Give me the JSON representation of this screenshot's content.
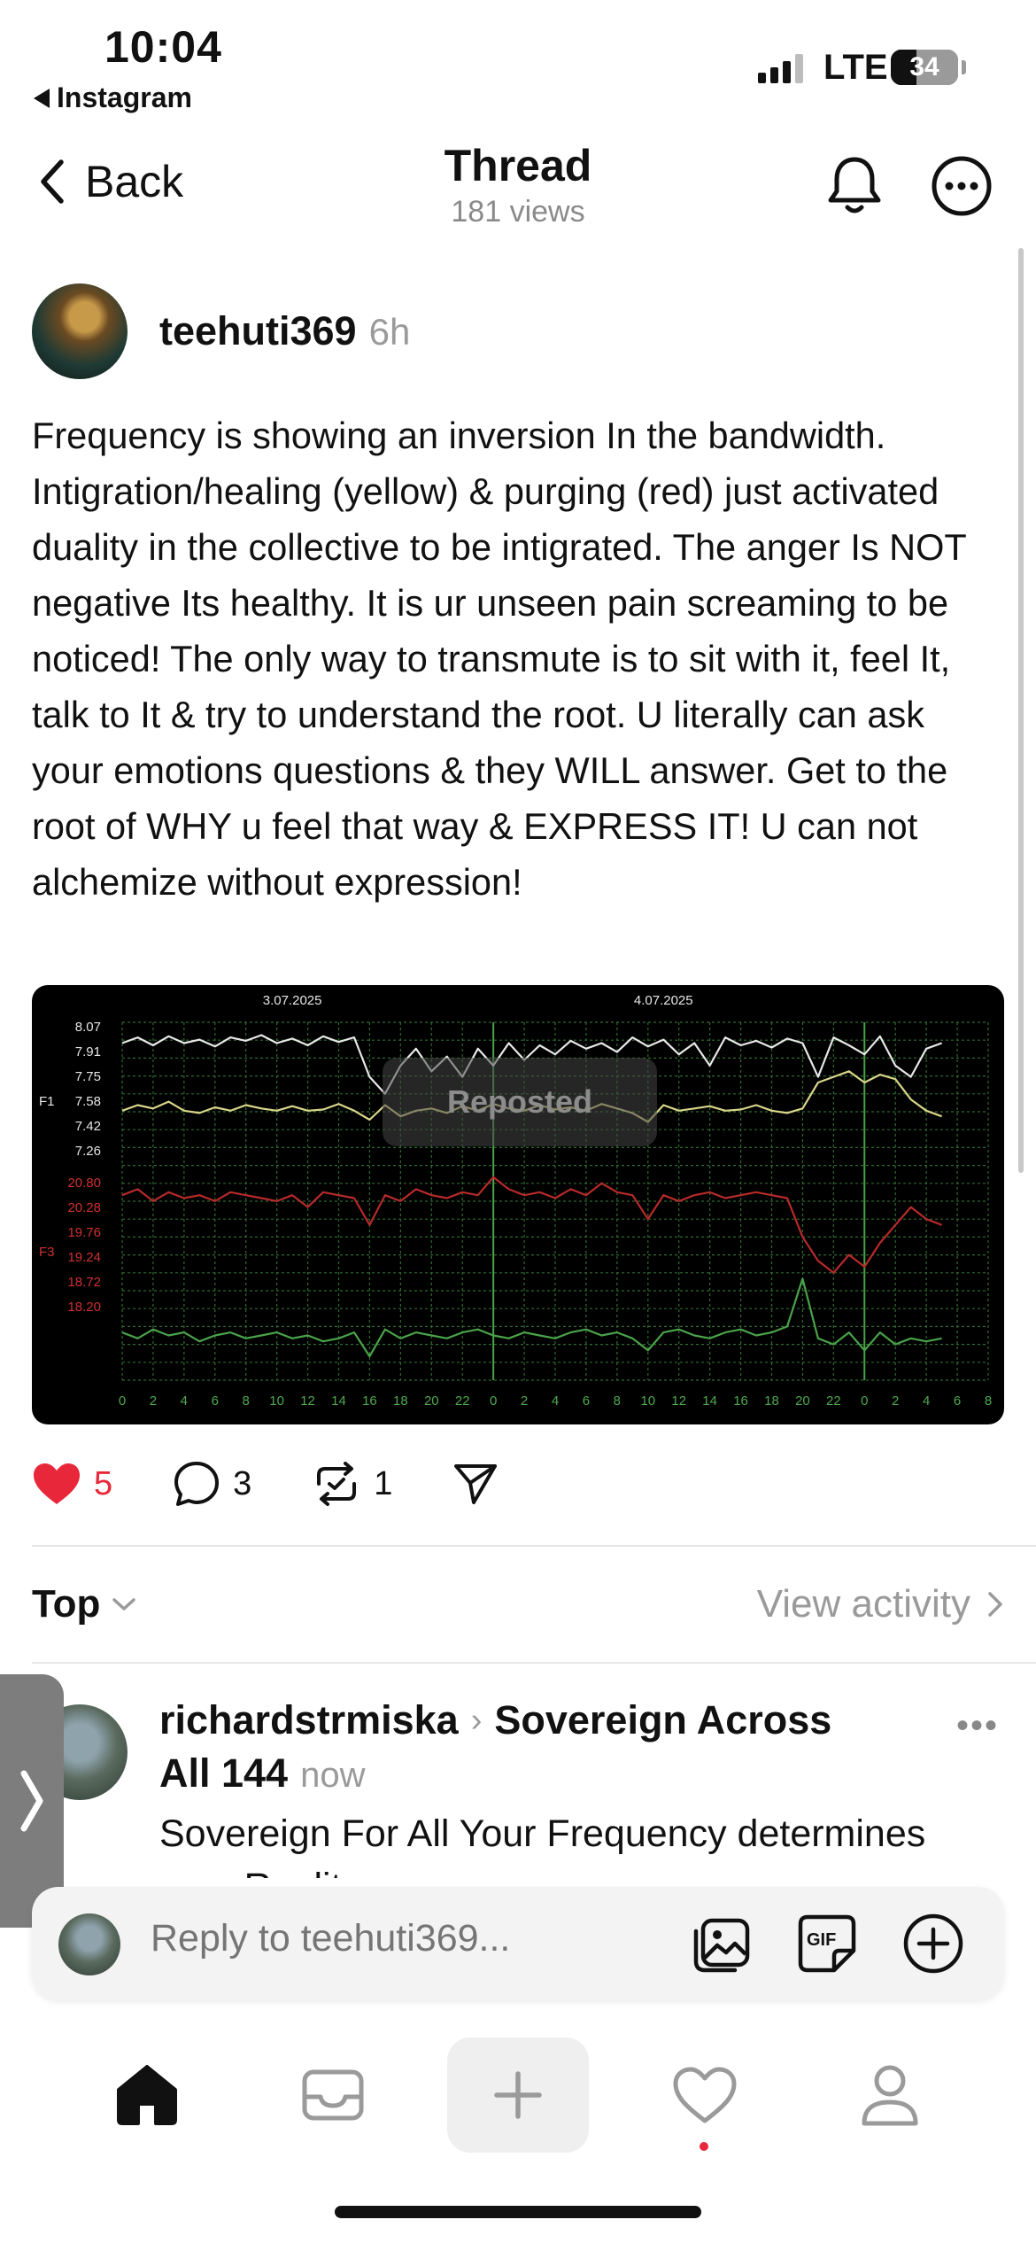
{
  "status_bar": {
    "time": "10:04",
    "back_app": "Instagram",
    "network": "LTE",
    "battery": "34"
  },
  "header": {
    "back_label": "Back",
    "title": "Thread",
    "views": "181 views"
  },
  "post": {
    "username": "teehuti369",
    "time_ago": "6h",
    "text": "Frequency is showing an inversion In the bandwidth. Intigration/healing (yellow) & purging (red) just activated duality in the collective to be intigrated. The anger Is NOT negative Its healthy. It is ur unseen pain screaming to be noticed! The only way to transmute is to sit with it, feel It, talk to It & try to understand the root. U literally can ask your emotions questions & they WILL answer. Get to the root of WHY u feel that way & EXPRESS IT! U can not alchemize without expression!",
    "image_overlay": "Reposted",
    "likes": "5",
    "replies": "3",
    "reposts": "1"
  },
  "chart_data": {
    "type": "line",
    "date_labels": [
      "3.07.2025",
      "4.07.2025"
    ],
    "panel_labels": [
      "F1",
      "F3"
    ],
    "y_ticks_f1": [
      "8.07",
      "7.91",
      "7.75",
      "7.58",
      "7.42",
      "7.26"
    ],
    "y_ticks_f3": [
      "20.80",
      "20.28",
      "19.76",
      "19.24",
      "18.72",
      "18.20"
    ],
    "x_ticks": [
      "0",
      "2",
      "4",
      "6",
      "8",
      "10",
      "12",
      "14",
      "16",
      "18",
      "20",
      "22",
      "0",
      "2",
      "4",
      "6",
      "8",
      "10",
      "12",
      "14",
      "16",
      "18",
      "20",
      "22",
      "0",
      "2",
      "4",
      "6",
      "8"
    ],
    "series": [
      {
        "color": "#e8e8e8",
        "values": [
          7.9,
          7.95,
          7.88,
          7.96,
          7.9,
          7.93,
          7.87,
          7.95,
          7.92,
          7.97,
          7.9,
          7.94,
          7.88,
          7.96,
          7.91,
          7.95,
          7.6,
          7.45,
          7.7,
          7.85,
          7.65,
          7.78,
          7.6,
          7.85,
          7.7,
          7.9,
          7.75,
          7.88,
          7.8,
          7.92,
          7.85,
          7.9,
          7.82,
          7.95,
          7.87,
          7.93,
          7.8,
          7.9,
          7.7,
          7.95,
          7.88,
          7.92,
          7.86,
          7.94,
          7.9,
          7.6,
          7.95,
          7.88,
          7.8,
          7.96,
          7.7,
          7.6,
          7.85,
          7.9
        ]
      },
      {
        "color": "#d9d68a",
        "values": [
          7.3,
          7.35,
          7.32,
          7.38,
          7.3,
          7.28,
          7.33,
          7.3,
          7.35,
          7.32,
          7.3,
          7.34,
          7.3,
          7.31,
          7.36,
          7.3,
          7.22,
          7.35,
          7.25,
          7.3,
          7.32,
          7.28,
          7.34,
          7.3,
          7.36,
          7.32,
          7.3,
          7.35,
          7.31,
          7.33,
          7.3,
          7.36,
          7.32,
          7.28,
          7.2,
          7.35,
          7.3,
          7.32,
          7.34,
          7.3,
          7.31,
          7.35,
          7.3,
          7.28,
          7.32,
          7.55,
          7.6,
          7.65,
          7.55,
          7.62,
          7.58,
          7.4,
          7.3,
          7.25
        ]
      },
      {
        "color": "#b82a2a",
        "values": [
          20.3,
          20.4,
          20.2,
          20.35,
          20.25,
          20.3,
          20.2,
          20.35,
          20.3,
          20.25,
          20.2,
          20.3,
          20.1,
          20.35,
          20.3,
          20.25,
          19.8,
          20.3,
          20.2,
          20.4,
          20.3,
          20.25,
          20.35,
          20.3,
          20.6,
          20.4,
          20.3,
          20.35,
          20.25,
          20.4,
          20.3,
          20.5,
          20.35,
          20.3,
          19.9,
          20.3,
          20.2,
          20.3,
          20.35,
          20.25,
          20.3,
          20.35,
          20.3,
          20.25,
          19.6,
          19.2,
          19.0,
          19.3,
          19.1,
          19.5,
          19.8,
          20.1,
          19.9,
          19.8
        ]
      },
      {
        "color": "#4aa34a",
        "values": [
          18.0,
          17.9,
          18.05,
          17.95,
          18.0,
          17.85,
          17.95,
          18.0,
          17.9,
          17.95,
          18.0,
          17.9,
          17.95,
          17.85,
          17.9,
          18.0,
          17.6,
          18.05,
          17.9,
          18.0,
          17.95,
          17.9,
          18.0,
          18.05,
          17.95,
          17.9,
          18.0,
          17.95,
          17.9,
          18.0,
          18.05,
          17.95,
          18.0,
          17.9,
          17.7,
          18.0,
          18.05,
          17.95,
          17.9,
          18.0,
          18.05,
          17.95,
          18.0,
          18.1,
          18.9,
          17.9,
          17.8,
          18.0,
          17.7,
          18.0,
          17.8,
          17.9,
          17.85,
          17.9
        ]
      }
    ]
  },
  "comments": {
    "sort_label": "Top",
    "view_activity": "View activity",
    "first": {
      "username": "richardstrmiska",
      "community": "Sovereign Across All 144",
      "community_part1": "Sovereign Across",
      "community_part2": "All 144",
      "time_ago": "now",
      "text": "Sovereign For All Your Frequency determines your Reality"
    }
  },
  "composer": {
    "placeholder": "Reply to teehuti369..."
  },
  "icons": {
    "back": "chevron-left-icon",
    "notifications": "bell-icon",
    "more": "more-circle-icon",
    "like": "heart-icon",
    "comment": "comment-icon",
    "repost": "repost-icon",
    "share": "send-icon",
    "media": "gallery-icon",
    "gif": "gif-icon",
    "add": "plus-circle-icon",
    "home": "home-icon",
    "inbox": "inbox-icon",
    "create": "plus-icon",
    "activity": "heart-outline-icon",
    "profile": "profile-icon"
  },
  "colors": {
    "like": "#e8283a",
    "muted": "#9a9a9a"
  }
}
